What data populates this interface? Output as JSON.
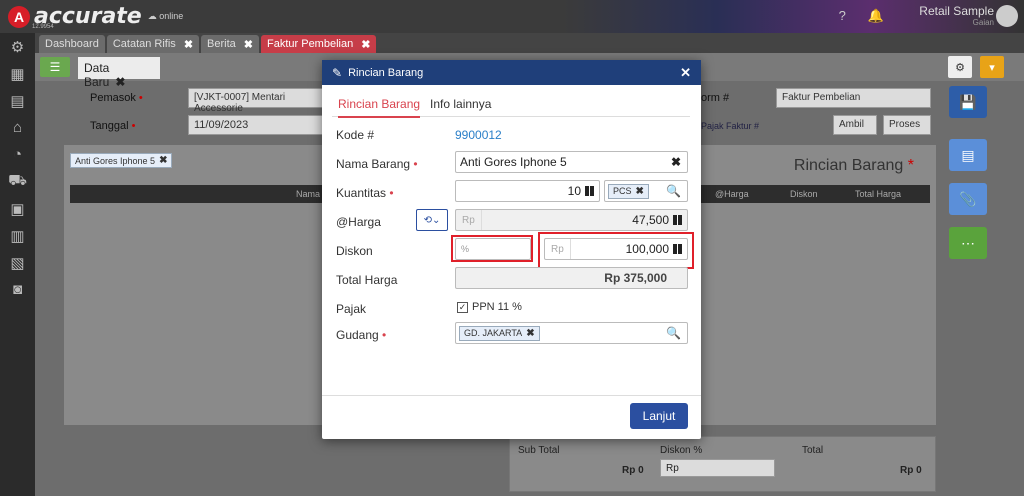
{
  "app": {
    "logo_mark": "A",
    "logo_text": "accurate",
    "logo_sub": "online",
    "logo_version": "12.9954",
    "user_name": "Retail Sample",
    "user_role": "Gaian"
  },
  "tabs": [
    {
      "label": "Dashboard"
    },
    {
      "label": "Catatan Rifis"
    },
    {
      "label": "Berita"
    },
    {
      "label": "Faktur Pembelian"
    }
  ],
  "form": {
    "subtab_label": "Data Baru",
    "pemasok_label": "Pemasok",
    "pemasok_value": "[VJKT-0007] Mentari Accessorie",
    "tanggal_label": "Tanggal",
    "tanggal_value": "11/09/2023",
    "form_label": "orm #",
    "form_value": "Faktur Pembelian",
    "link_label": "Pajak Faktur #",
    "ambil_label": "Ambil",
    "proses_label": "Proses",
    "item_chip": "Anti Gores Iphone 5",
    "title": "Rincian Barang",
    "col_nama": "Nama Barang",
    "col_harga": "@Harga",
    "col_diskon": "Diskon",
    "col_total": "Total Harga"
  },
  "totals": {
    "subtotal_label": "Sub Total",
    "subtotal_value": "Rp 0",
    "diskon_label": "Diskon",
    "diskon_unit": "%",
    "diskon_placeholder": "Rp",
    "total_label": "Total",
    "total_value": "Rp 0"
  },
  "modal": {
    "title": "Rincian Barang",
    "tab_rincian": "Rincian Barang",
    "tab_info": "Info lainnya",
    "kode_label": "Kode #",
    "kode_value": "9900012",
    "nama_label": "Nama Barang",
    "nama_value": "Anti Gores Iphone 5",
    "kuantitas_label": "Kuantitas",
    "kuantitas_value": "10",
    "unit_value": "PCS",
    "harga_label": "@Harga",
    "harga_prefix": "Rp",
    "harga_value": "47,500",
    "diskon_label": "Diskon",
    "diskon_percent_placeholder": "%",
    "diskon_prefix": "Rp",
    "diskon_value": "100,000",
    "total_label": "Total Harga",
    "total_value": "Rp 375,000",
    "pajak_label": "Pajak",
    "pajak_option": "PPN 11 %",
    "gudang_label": "Gudang",
    "gudang_value": "GD. JAKARTA",
    "lanjut_label": "Lanjut"
  },
  "colors": {
    "accent_red": "#d9434e",
    "header_blue": "#1f3f7a",
    "button_blue": "#2b4fa0",
    "highlight": "#e0202a"
  }
}
